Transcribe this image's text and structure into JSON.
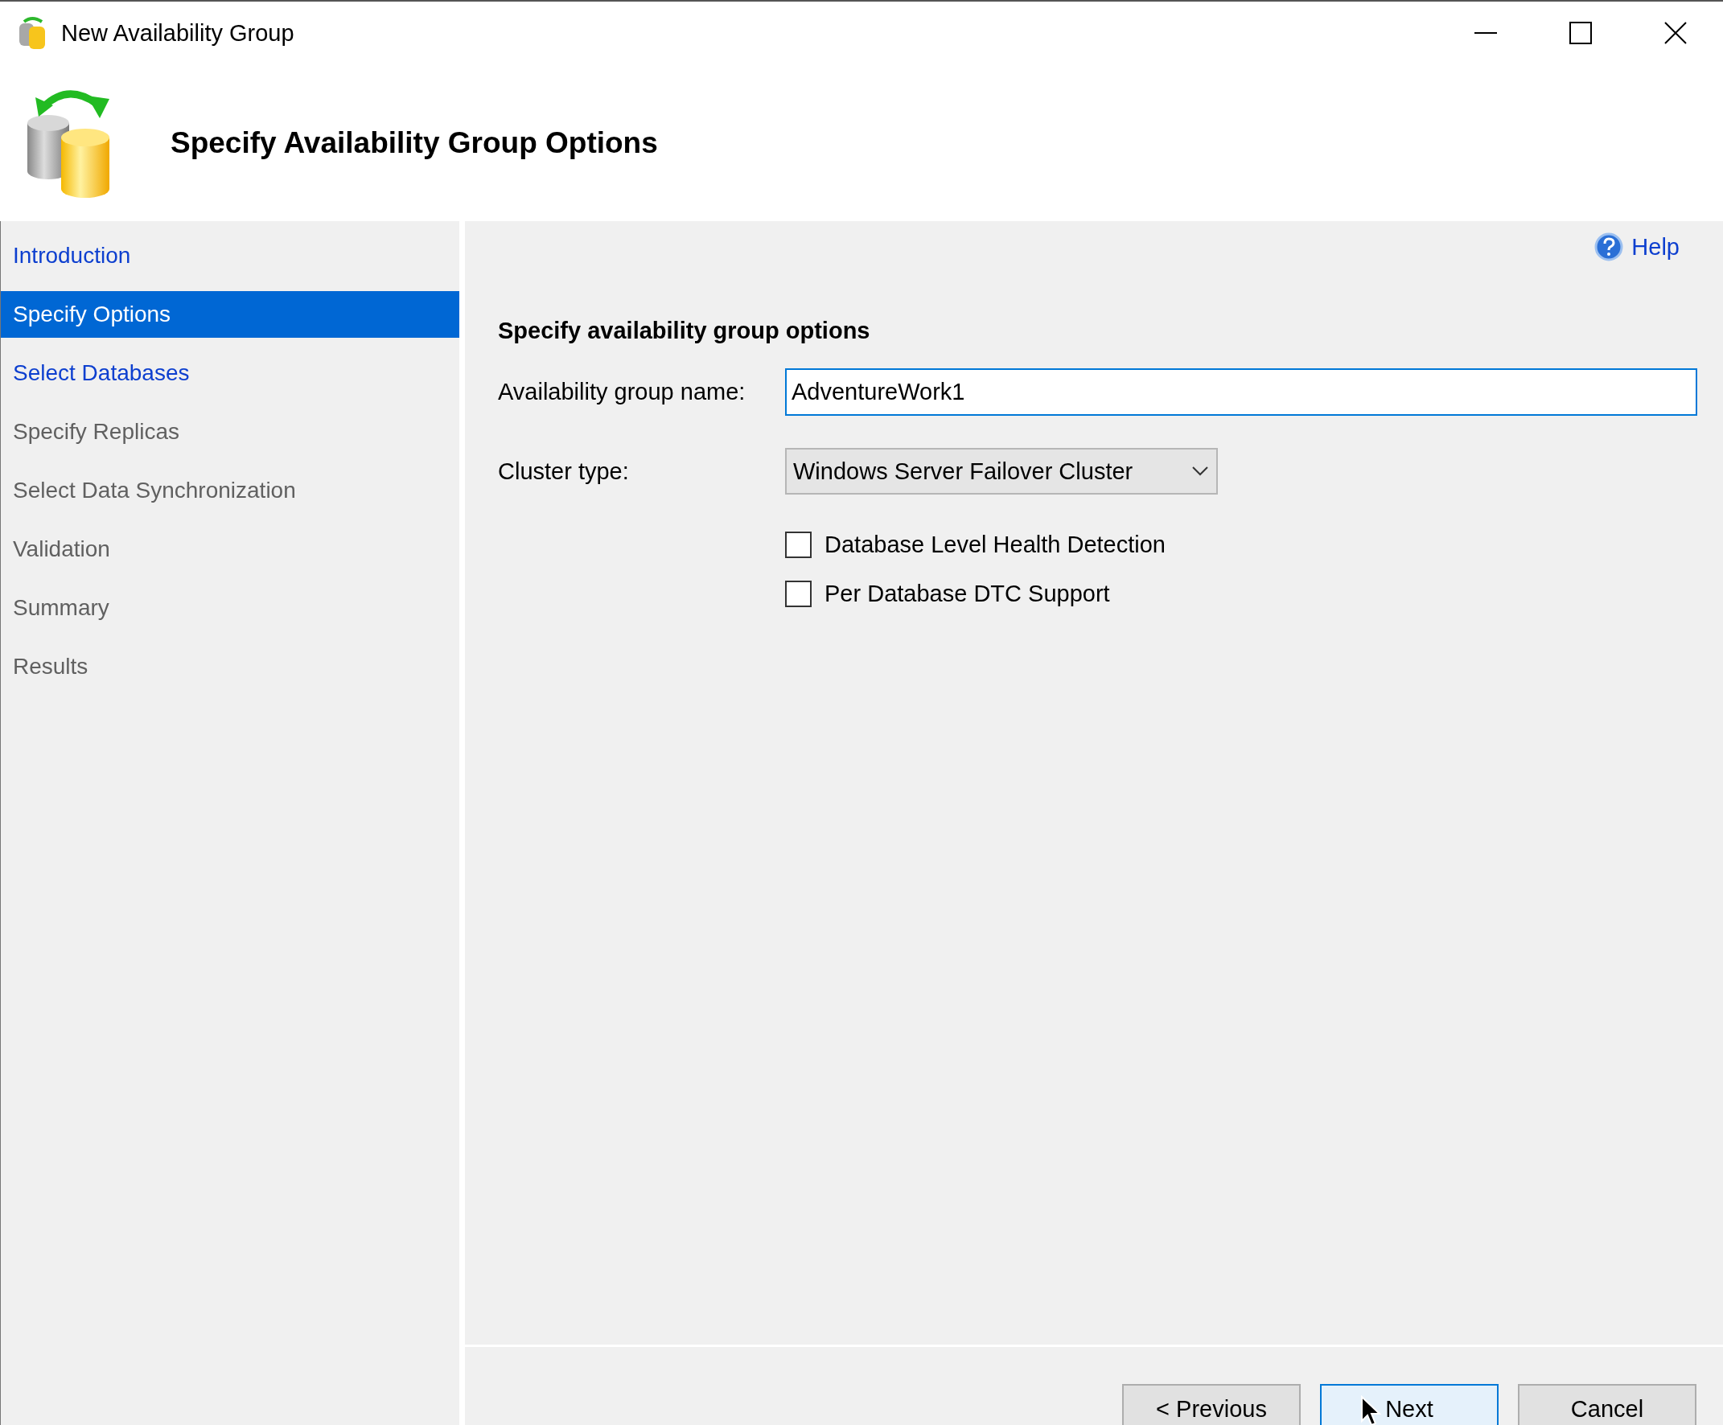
{
  "window": {
    "title": "New Availability Group"
  },
  "header": {
    "title": "Specify Availability Group Options"
  },
  "sidebar": {
    "items": [
      {
        "label": "Introduction",
        "selected": false,
        "disabled": false
      },
      {
        "label": "Specify Options",
        "selected": true,
        "disabled": false
      },
      {
        "label": "Select Databases",
        "selected": false,
        "disabled": false
      },
      {
        "label": "Specify Replicas",
        "selected": false,
        "disabled": true
      },
      {
        "label": "Select Data Synchronization",
        "selected": false,
        "disabled": true
      },
      {
        "label": "Validation",
        "selected": false,
        "disabled": true
      },
      {
        "label": "Summary",
        "selected": false,
        "disabled": true
      },
      {
        "label": "Results",
        "selected": false,
        "disabled": true
      }
    ]
  },
  "help": {
    "label": "Help"
  },
  "options": {
    "heading": "Specify availability group options",
    "name_label": "Availability group name:",
    "name_value": "AdventureWork1",
    "cluster_label": "Cluster type:",
    "cluster_value": "Windows Server Failover Cluster",
    "checkboxes": [
      {
        "label": "Database Level Health Detection",
        "checked": false
      },
      {
        "label": "Per Database DTC Support",
        "checked": false
      }
    ]
  },
  "buttons": [
    {
      "label": "< Previous",
      "default": false
    },
    {
      "label": "Next",
      "default": true
    },
    {
      "label": "Cancel",
      "default": false
    }
  ]
}
